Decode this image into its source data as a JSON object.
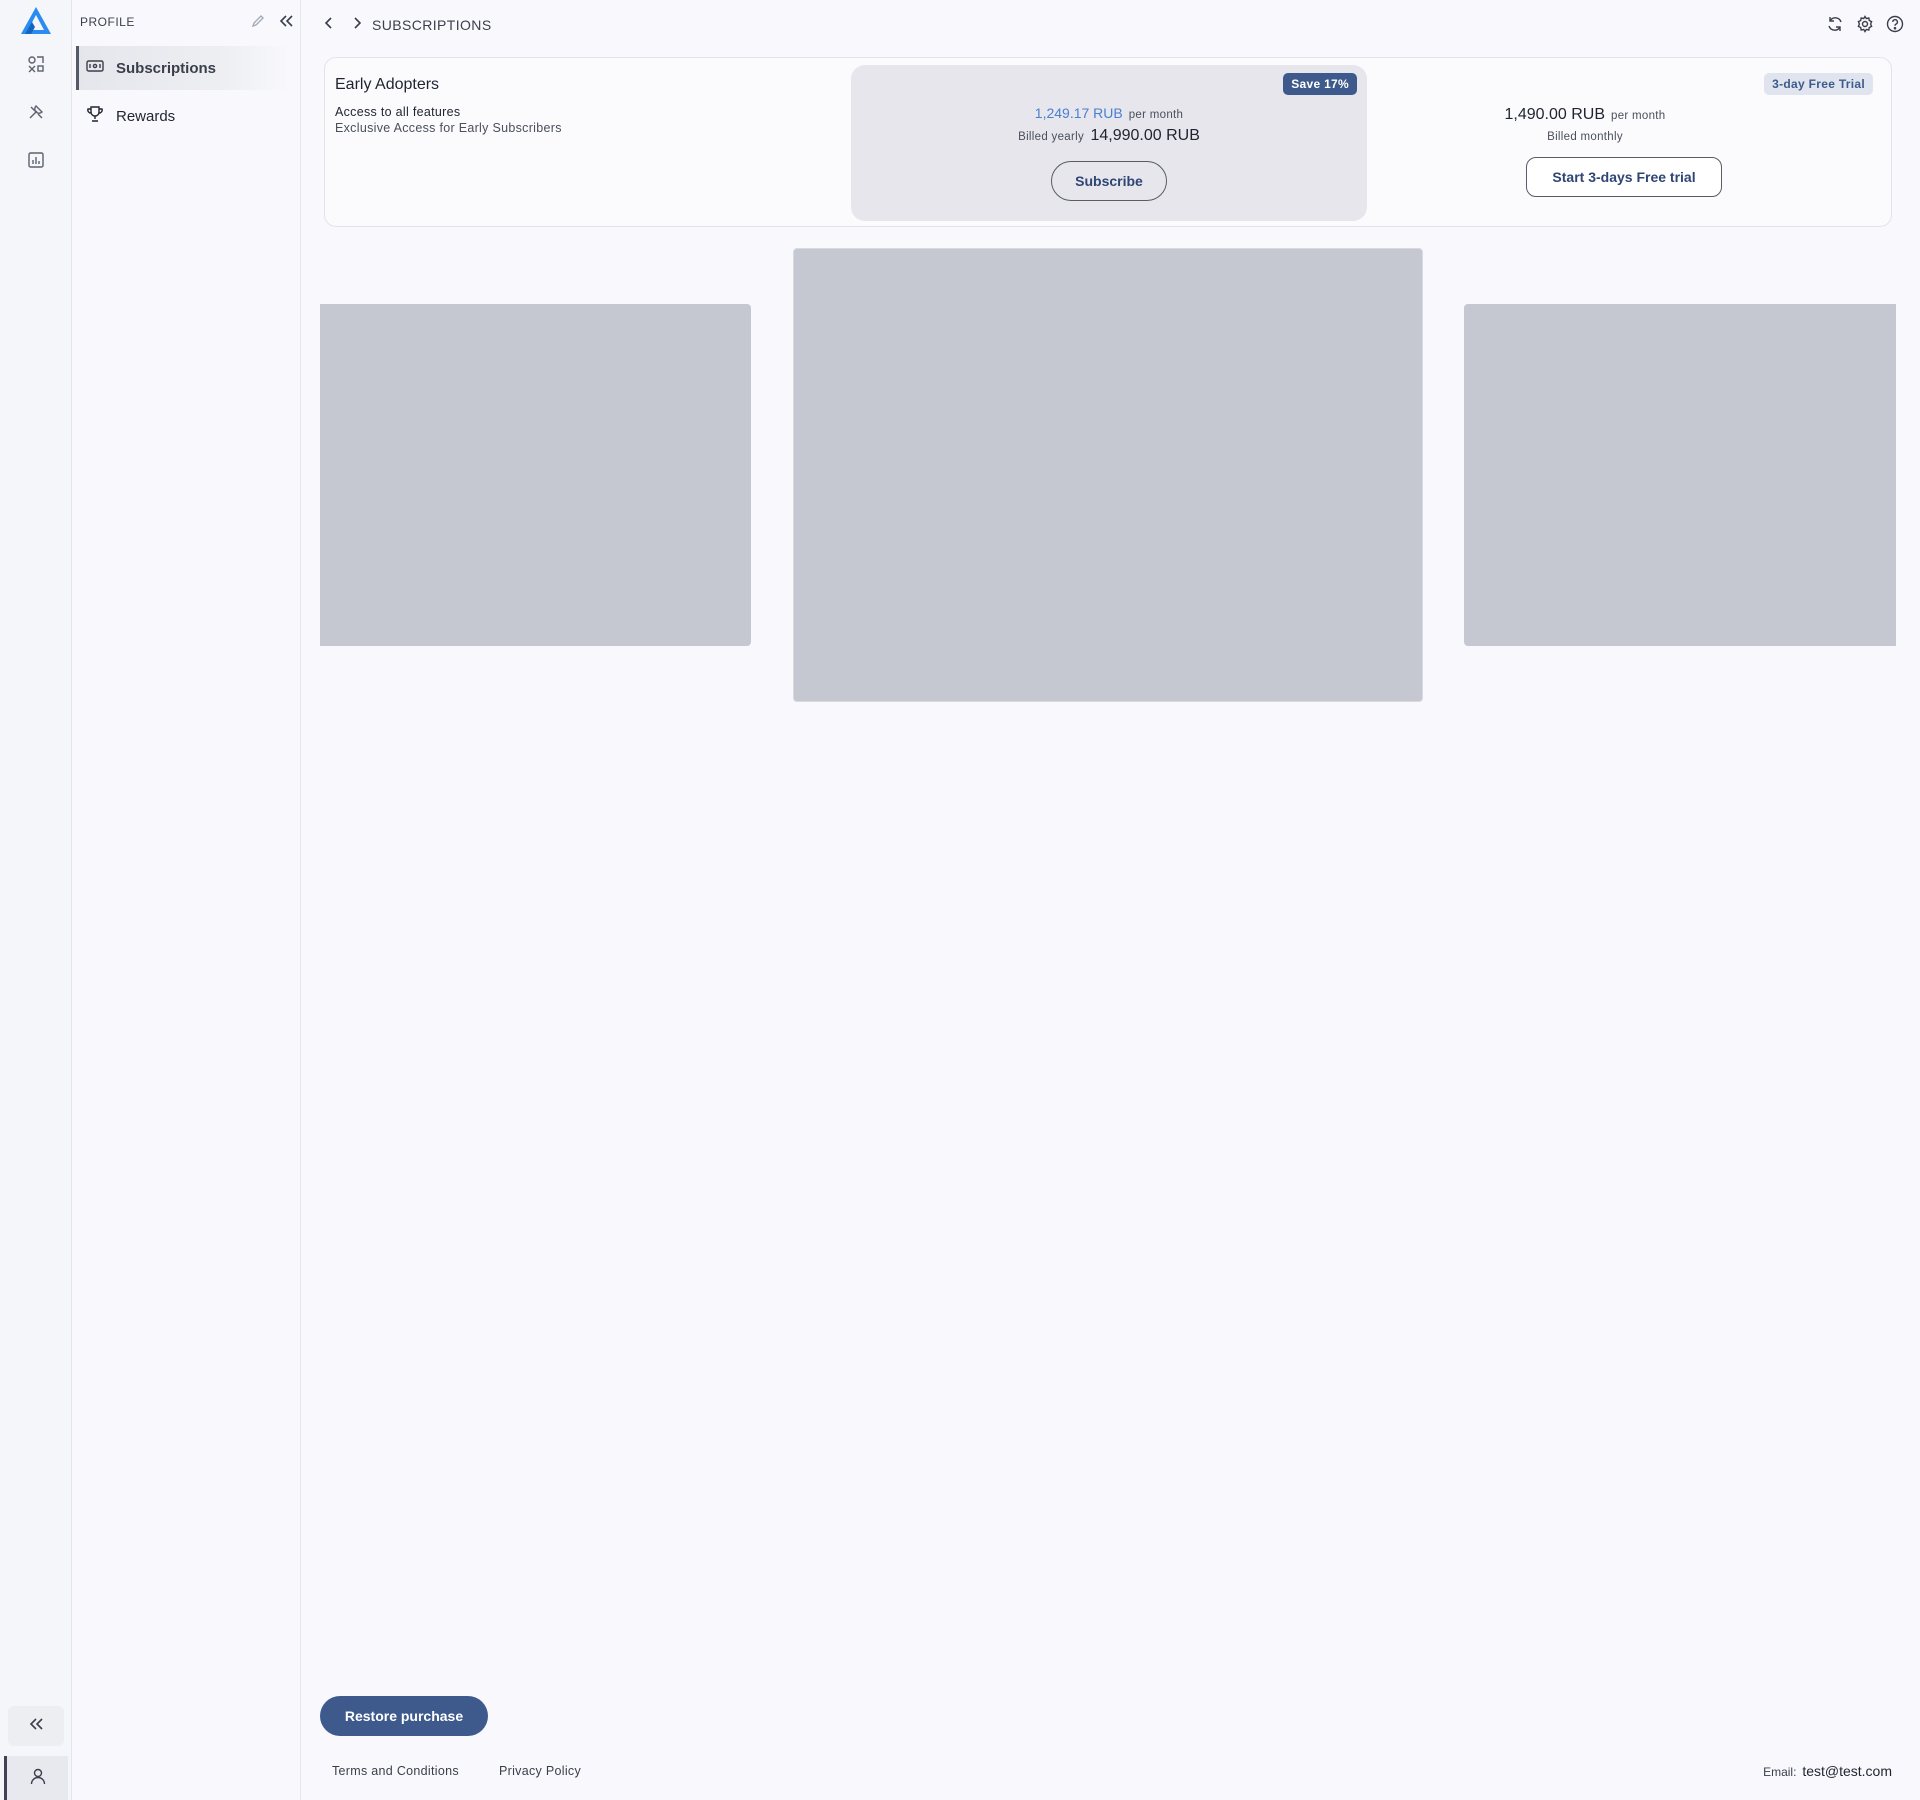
{
  "sidebar": {
    "title": "PROFILE",
    "items": [
      {
        "label": "Subscriptions",
        "icon": "ticket-icon",
        "active": true
      },
      {
        "label": "Rewards",
        "icon": "trophy-icon",
        "active": false
      }
    ]
  },
  "header": {
    "breadcrumb": "SUBSCRIPTIONS"
  },
  "plan": {
    "name": "Early Adopters",
    "features": "Access to all features",
    "subtitle": "Exclusive Access for Early Subscribers",
    "yearly": {
      "badge": "Save 17%",
      "monthly_price": "1,249.17 RUB",
      "per_month": "per month",
      "billed_label": "Billed yearly",
      "billed_value": "14,990.00 RUB",
      "button": "Subscribe"
    },
    "monthly": {
      "badge": "3-day Free Trial",
      "price": "1,490.00 RUB",
      "per_month": "per month",
      "billed_label": "Billed monthly",
      "button": "Start 3-days Free trial"
    }
  },
  "footer": {
    "restore_button": "Restore purchase",
    "terms": "Terms and Conditions",
    "privacy": "Privacy Policy",
    "email_label": "Email:",
    "email_value": "test@test.com"
  },
  "colors": {
    "accent": "#3e5a8c",
    "price_link": "#4a7fd1",
    "placeholder": "#c5c8d1",
    "logo": "#2a8cf0"
  }
}
